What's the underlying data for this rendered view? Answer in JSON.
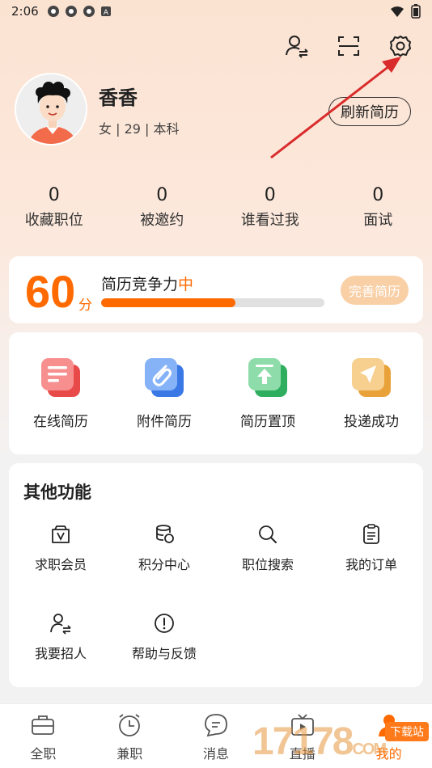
{
  "status_bar": {
    "time": "2:06"
  },
  "profile": {
    "name": "香香",
    "meta": "女 | 29 | 本科",
    "refresh_label": "刷新简历"
  },
  "stats": [
    {
      "value": "0",
      "label": "收藏职位"
    },
    {
      "value": "0",
      "label": "被邀约"
    },
    {
      "value": "0",
      "label": "谁看过我"
    },
    {
      "value": "0",
      "label": "面试"
    }
  ],
  "score": {
    "number": "60",
    "unit": "分",
    "title": "简历竞争力",
    "level": "中",
    "progress": 0.6,
    "improve_label": "完善简历"
  },
  "resume_actions": [
    {
      "label": "在线简历",
      "icon": "online-resume-icon",
      "color": "#f26b6b"
    },
    {
      "label": "附件简历",
      "icon": "attachment-icon",
      "color": "#4a8cf0"
    },
    {
      "label": "简历置顶",
      "icon": "top-arrow-icon",
      "color": "#3cbf6e"
    },
    {
      "label": "投递成功",
      "icon": "send-icon",
      "color": "#f0b04a"
    }
  ],
  "other_functions": {
    "title": "其他功能",
    "items": [
      {
        "label": "求职会员",
        "icon": "vip-icon"
      },
      {
        "label": "积分中心",
        "icon": "coins-icon"
      },
      {
        "label": "职位搜索",
        "icon": "search-icon"
      },
      {
        "label": "我的订单",
        "icon": "clipboard-icon"
      },
      {
        "label": "我要招人",
        "icon": "recruit-icon"
      },
      {
        "label": "帮助与反馈",
        "icon": "help-icon"
      }
    ]
  },
  "tabs": [
    {
      "label": "全职",
      "icon": "briefcase-icon"
    },
    {
      "label": "兼职",
      "icon": "clock-icon"
    },
    {
      "label": "消息",
      "icon": "chat-icon"
    },
    {
      "label": "直播",
      "icon": "tv-icon"
    },
    {
      "label": "我的",
      "icon": "person-icon",
      "active": true
    }
  ],
  "watermark": {
    "text": "17178",
    "badge": "下载站",
    "suffix": "COM"
  },
  "colors": {
    "accent": "#ff6a00",
    "annotation_arrow": "#d92b2b"
  }
}
